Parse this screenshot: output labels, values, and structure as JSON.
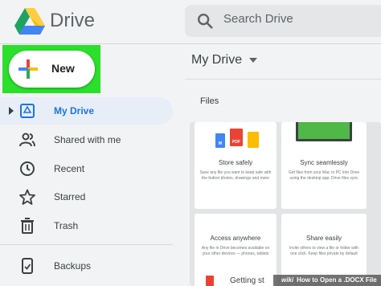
{
  "header": {
    "app_title": "Drive",
    "logo_icon": "google-drive-logo",
    "search": {
      "icon": "search-icon",
      "placeholder": "Search Drive"
    }
  },
  "new_button": {
    "label": "New",
    "icon": "plus-icon",
    "highlight_color": "#2be02b"
  },
  "sidebar": {
    "items": [
      {
        "label": "My Drive",
        "icon": "my-drive-icon",
        "active": true
      },
      {
        "label": "Shared with me",
        "icon": "people-icon",
        "active": false
      },
      {
        "label": "Recent",
        "icon": "clock-icon",
        "active": false
      },
      {
        "label": "Starred",
        "icon": "star-icon",
        "active": false
      },
      {
        "label": "Trash",
        "icon": "trash-icon",
        "active": false
      },
      {
        "label": "Backups",
        "icon": "backups-icon",
        "active": false
      }
    ]
  },
  "main": {
    "title": "My Drive",
    "section_label": "Files",
    "cards": [
      {
        "title": "Store safely",
        "text": "Save any file you want to keep safe with the button photos, drawings and more"
      },
      {
        "title": "Sync seamlessly",
        "text": "Get files from your Mac or PC into Drive using the desktop app. Drive files sync"
      },
      {
        "title": "Access anywhere",
        "text": "Any file in Drive becomes available on your other devices — phones, tablets"
      },
      {
        "title": "Share easily",
        "text": "Invite others to view a file or folder with one click. Keep files private by default"
      }
    ],
    "partial_card_title": "Getting st",
    "file_icons": [
      {
        "label": "W",
        "color": "#4285f4"
      },
      {
        "label": "PDF",
        "color": "#ea4335"
      },
      {
        "label": "",
        "color": "#fbbc04"
      }
    ]
  },
  "watermark": {
    "prefix": "wiki",
    "text": "How to Open a .DOCX File"
  },
  "colors": {
    "accent": "#1a73e8",
    "active_bg": "#e8eef8",
    "sync_green": "#4fb847"
  }
}
